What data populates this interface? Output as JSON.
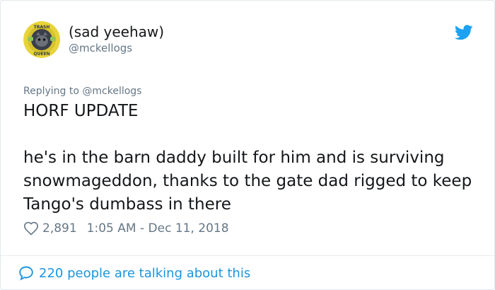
{
  "tweet": {
    "display_name": "(sad yeehaw)",
    "handle": "@mckellogs",
    "avatar": {
      "icon": "avatar-badge-icon",
      "top_text": "TRASH",
      "bottom_text": "QUEEN",
      "ring_color": "#e8d43a",
      "inner_color": "#3a3f4b"
    },
    "replying_to_label": "Replying to",
    "replying_to_handle": "@mckellogs",
    "text": "HORF UPDATE\n\nhe's in the barn daddy built for him and is surviving snowmageddon, thanks to the gate dad rigged to keep Tango's dumbass in there",
    "like_count": "2,891",
    "time": "1:05 AM",
    "separator": "-",
    "date": "Dec 11, 2018",
    "talking_text": "220 people are talking about this"
  },
  "colors": {
    "text": "#14171a",
    "secondary": "#657786",
    "twitter_blue": "#1da1f2",
    "link_blue": "#1b95e0"
  }
}
